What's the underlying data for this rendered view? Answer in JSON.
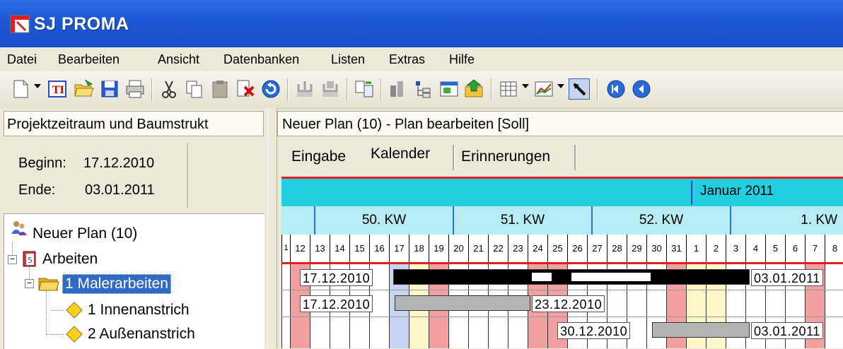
{
  "app": {
    "title": "SJ PROMA"
  },
  "menu": [
    "Datei",
    "Bearbeiten",
    "Ansicht",
    "Datenbanken",
    "Listen",
    "Extras",
    "Hilfe"
  ],
  "toolbar": {
    "icons": [
      "new-document-icon",
      "template-icon",
      "open-folder-icon",
      "save-icon",
      "print-icon",
      "cut-icon",
      "copy-icon",
      "paste-icon",
      "delete-icon",
      "undo-icon",
      "check-in-icon",
      "check-out-icon",
      "compare-icon",
      "chart-icon",
      "tree-view-icon",
      "window-icon",
      "export-icon",
      "table-icon",
      "line-chart-icon",
      "pointer-tool-icon",
      "first-record-icon",
      "previous-record-icon"
    ]
  },
  "left": {
    "header": "Projektzeitraum und Baumstrukt",
    "begin_label": "Beginn:",
    "begin_value": "17.12.2010",
    "end_label": "Ende:",
    "end_value": "03.01.2011",
    "tree": [
      {
        "label": "Neuer Plan (10)",
        "icon": "project-users-icon",
        "level": 0
      },
      {
        "label": "Arbeiten",
        "icon": "calendar-book-icon",
        "level": 1
      },
      {
        "label": "1 Malerarbeiten",
        "icon": "folder-icon",
        "level": 2,
        "selected": true
      },
      {
        "label": "1 Innenanstrich",
        "icon": "diamond-icon",
        "level": 3
      },
      {
        "label": "2 Außenanstrich",
        "icon": "diamond-icon",
        "level": 3
      }
    ]
  },
  "right": {
    "header": "Neuer Plan (10) - Plan bearbeiten [Soll]",
    "tabs": [
      "Eingabe",
      "Kalender",
      "Erinnerungen"
    ],
    "active_tab": "Kalender"
  },
  "gantt": {
    "month": "Januar 2011",
    "weeks": [
      "50. KW",
      "51. KW",
      "52. KW",
      "1. KW"
    ],
    "days": [
      "1",
      "12",
      "13",
      "14",
      "15",
      "16",
      "17",
      "18",
      "19",
      "20",
      "21",
      "22",
      "23",
      "24",
      "25",
      "26",
      "27",
      "28",
      "29",
      "30",
      "31",
      "1",
      "2",
      "3",
      "4",
      "5",
      "6",
      "7",
      "8"
    ],
    "rows": [
      {
        "start_label": "17.12.2010",
        "end_label": "03.01.2011",
        "type": "summary"
      },
      {
        "start_label": "17.12.2010",
        "end_label": "23.12.2010",
        "type": "task"
      },
      {
        "start_label": "30.12.2010",
        "end_label": "03.01.2011",
        "type": "task"
      }
    ],
    "colors": {
      "month_bg": "#22cfe0",
      "week_bg": "#b8ecf4",
      "weekend_pink": "#f4a0a0",
      "highlight_blue": "#c8d4f4",
      "highlight_yellow": "#fdf6c8",
      "summary_bar": "#000000",
      "task_bar": "#b4b4b4"
    }
  }
}
